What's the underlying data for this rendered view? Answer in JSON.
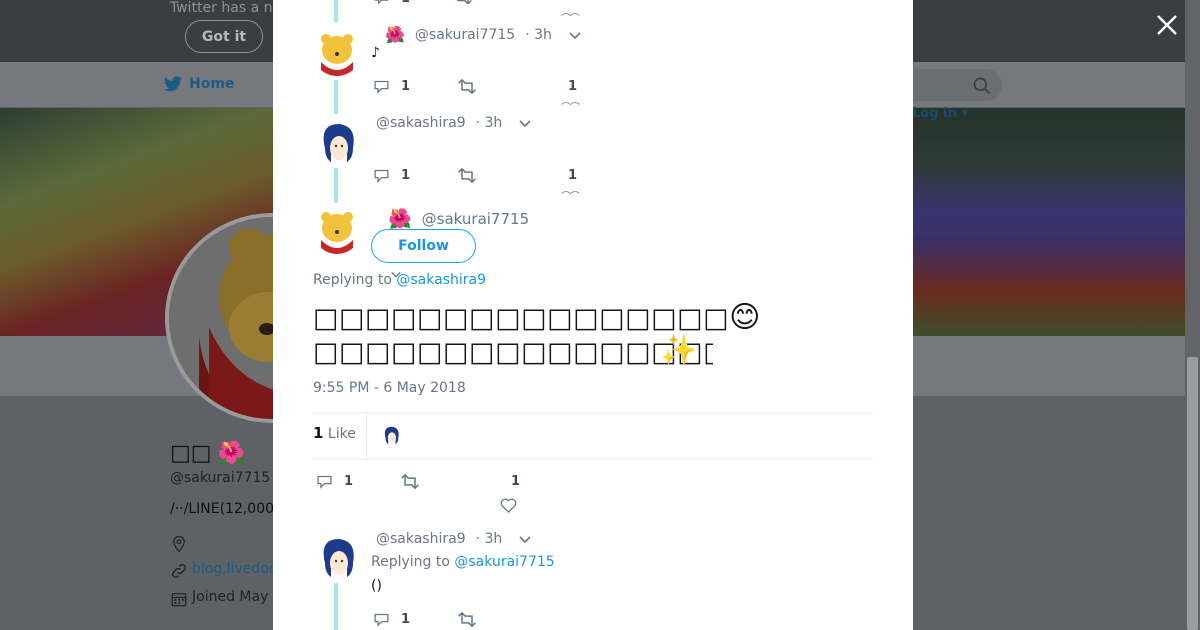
{
  "background": {
    "banner_text": "Twitter has a n",
    "got_it_label": "Got it",
    "nav_home_label": "Home",
    "login_label": "Log in",
    "profile_name": "□□",
    "profile_name_emoji": "🌺",
    "profile_handle": "@sakurai7715",
    "profile_bio": "/··/LINE(12,000",
    "profile_link": "blog.livedoo",
    "profile_joined": "Joined May",
    "smiley": "😃"
  },
  "thread": [
    {
      "handle": "@sakurai7715",
      "flower": "🌺",
      "time": "· 3h",
      "text": "♪",
      "reply_count": "1",
      "like_count": "1"
    },
    {
      "handle": "@sakashira9",
      "time": "· 3h",
      "reply_count": "1",
      "like_count": "1"
    }
  ],
  "main_tweet": {
    "handle": "@sakurai7715",
    "flower": "🌺",
    "follow_label": "Follow",
    "replying_prefix": "Replying to",
    "replying_to": "@sakashira9",
    "line1": "□□□□□□□□□□□□□□□□",
    "line1_emoji": "😊",
    "line2": "□□□□□□□□□□□□□□□□□□□□□□□□□□□□□□□□□□□□□□□□□□□□□□□□□□□□□□□□□□□□□□□□□□□□□□□□□□□□□□□□□□□□□□□□",
    "line2_emoji": "✨",
    "timestamp": "9:55 PM - 6 May 2018",
    "likes_number": "1",
    "likes_word": "Like",
    "reply_count": "1",
    "like_count": "1"
  },
  "reply": {
    "handle": "@sakashira9",
    "time": "· 3h",
    "replying_prefix": "Replying to",
    "replying_to": "@sakurai7715",
    "text": "()",
    "reply_count": "1"
  },
  "colors": {
    "accent": "#1da1f2",
    "thread_line": "#aee0f4",
    "muted": "#657786"
  }
}
